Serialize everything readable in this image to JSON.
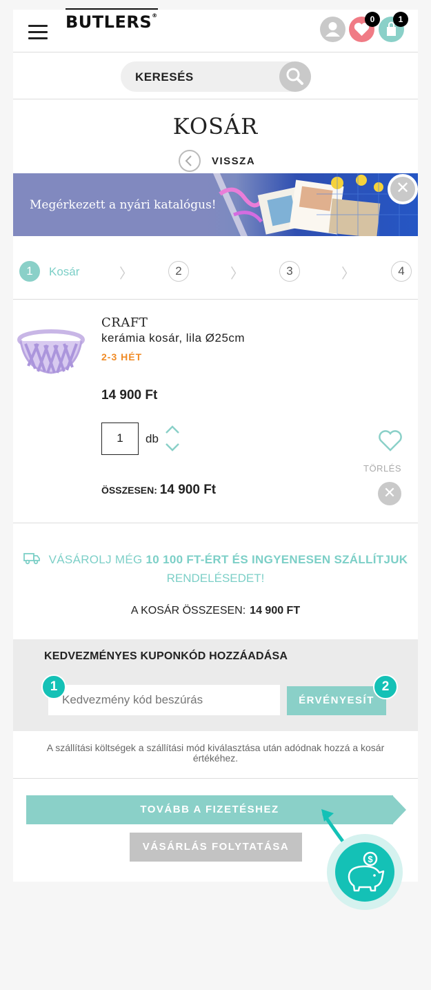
{
  "header": {
    "logo": "BUTLERS",
    "logo_mark": "®",
    "wishlist_count": "0",
    "cart_count": "1"
  },
  "search": {
    "label": "KERESÉS"
  },
  "page": {
    "title": "KOSÁR",
    "back_label": "VISSZA"
  },
  "banner": {
    "text": "Megérkezett a nyári katalógus!"
  },
  "steps": [
    {
      "num": "1",
      "label": "Kosár"
    },
    {
      "num": "2"
    },
    {
      "num": "3"
    },
    {
      "num": "4"
    }
  ],
  "product": {
    "brand": "CRAFT",
    "name": "kerámia kosár, lila Ø25cm",
    "delivery": "2-3 HÉT",
    "price": "14 900 Ft",
    "qty": "1",
    "unit": "db",
    "total_label": "ÖSSZESEN:",
    "total_value": "14 900 Ft",
    "delete_label": "TÖRLÉS"
  },
  "shipping": {
    "line1_a": "VÁSÁROLJ MÉG",
    "line1_b": "10 100 FT-ÉRT ÉS INGYENESEN SZÁLLÍTJUK",
    "line2": "RENDELÉSEDET!",
    "total_label": "A KOSÁR ÖSSZESEN:",
    "total_value": "14 900 FT"
  },
  "coupon": {
    "title": "KEDVEZMÉNYES KUPONKÓD HOZZÁADÁSA",
    "placeholder": "Kedvezmény kód beszúrás",
    "button": "ÉRVÉNYESÍT",
    "badge1": "1",
    "badge2": "2"
  },
  "note": "A szállítási költségek a szállítási mód kiválasztása után adódnak hozzá a kosár értékéhez.",
  "actions": {
    "checkout": "TOVÁBB A FIZETÉSHEZ",
    "continue": "VÁSÁRLÁS FOLYTATÁSA"
  },
  "colors": {
    "teal": "#8ad0c8",
    "accent": "#14c1b6",
    "orange": "#f08a24",
    "wishlist": "#f07b85"
  }
}
